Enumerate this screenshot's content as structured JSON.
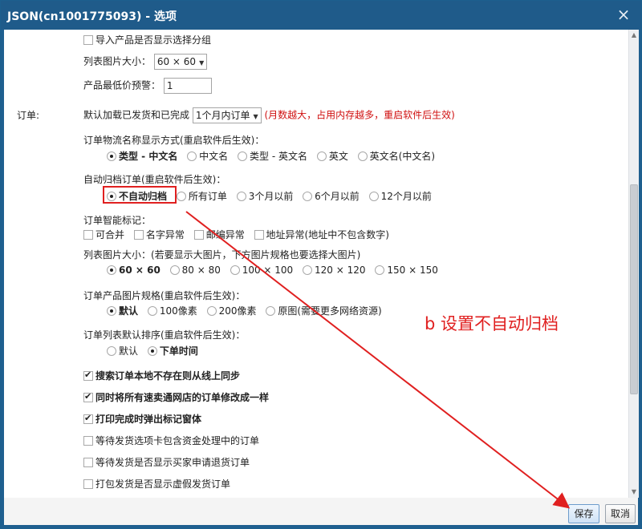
{
  "window": {
    "title": "JSON(cn1001775093) - 选项",
    "close_glyph": "×"
  },
  "import": {
    "group_label": "导入产品是否显示选择分组",
    "group_checked": false
  },
  "list_image": {
    "label": "列表图片大小：",
    "value": "60 × 60"
  },
  "min_price": {
    "label": "产品最低价预警：",
    "value": "1"
  },
  "orders": {
    "section_label": "订单:",
    "default_load": {
      "label": "默认加载已发货和已完成",
      "value": "1个月内订单",
      "hint": "(月数越大，占用内存越多，重启软件后生效)"
    },
    "logistics": {
      "label": "订单物流名称显示方式(重启软件后生效)：",
      "options": [
        "类型 - 中文名",
        "中文名",
        "类型 - 英文名",
        "英文",
        "英文名(中文名)"
      ],
      "selected": 0
    },
    "archive": {
      "label": "自动归档订单(重启软件后生效)：",
      "options": [
        "不自动归档",
        "所有订单",
        "3个月以前",
        "6个月以前",
        "12个月以前"
      ],
      "selected": 0
    },
    "smart_tags": {
      "label": "订单智能标记：",
      "options": [
        "可合并",
        "名字异常",
        "邮编异常",
        "地址异常(地址中不包含数字)"
      ]
    },
    "list_image": {
      "label": "列表图片大小：(若要显示大图片，下方图片规格也要选择大图片)",
      "options": [
        "60 × 60",
        "80 × 80",
        "100 × 100",
        "120 × 120",
        "150 × 150"
      ],
      "selected": 0
    },
    "product_image": {
      "label": "订单产品图片规格(重启软件后生效)：",
      "options": [
        "默认",
        "100像素",
        "200像素",
        "原图(需要更多网络资源)"
      ],
      "selected": 0
    },
    "sort": {
      "label": "订单列表默认排序(重启软件后生效)：",
      "options": [
        "默认",
        "下单时间"
      ],
      "selected": 1
    },
    "checks": [
      {
        "label": "搜索订单本地不存在则从线上同步",
        "checked": true
      },
      {
        "label": "同时将所有速卖通网店的订单修改成一样",
        "checked": true
      },
      {
        "label": "打印完成时弹出标记窗体",
        "checked": true
      },
      {
        "label": "等待发货选项卡包含资金处理中的订单",
        "checked": false
      },
      {
        "label": "等待发货是否显示买家申请退货订单",
        "checked": false
      },
      {
        "label": "打包发货是否显示虚假发货订单",
        "checked": false
      }
    ]
  },
  "footer": {
    "save": "保存",
    "cancel": "取消"
  },
  "annotation": {
    "text": "b 设置不自动归档",
    "color": "#e02020"
  },
  "colors": {
    "titlebar": "#1f5b8a",
    "accent_red": "#e02020"
  }
}
